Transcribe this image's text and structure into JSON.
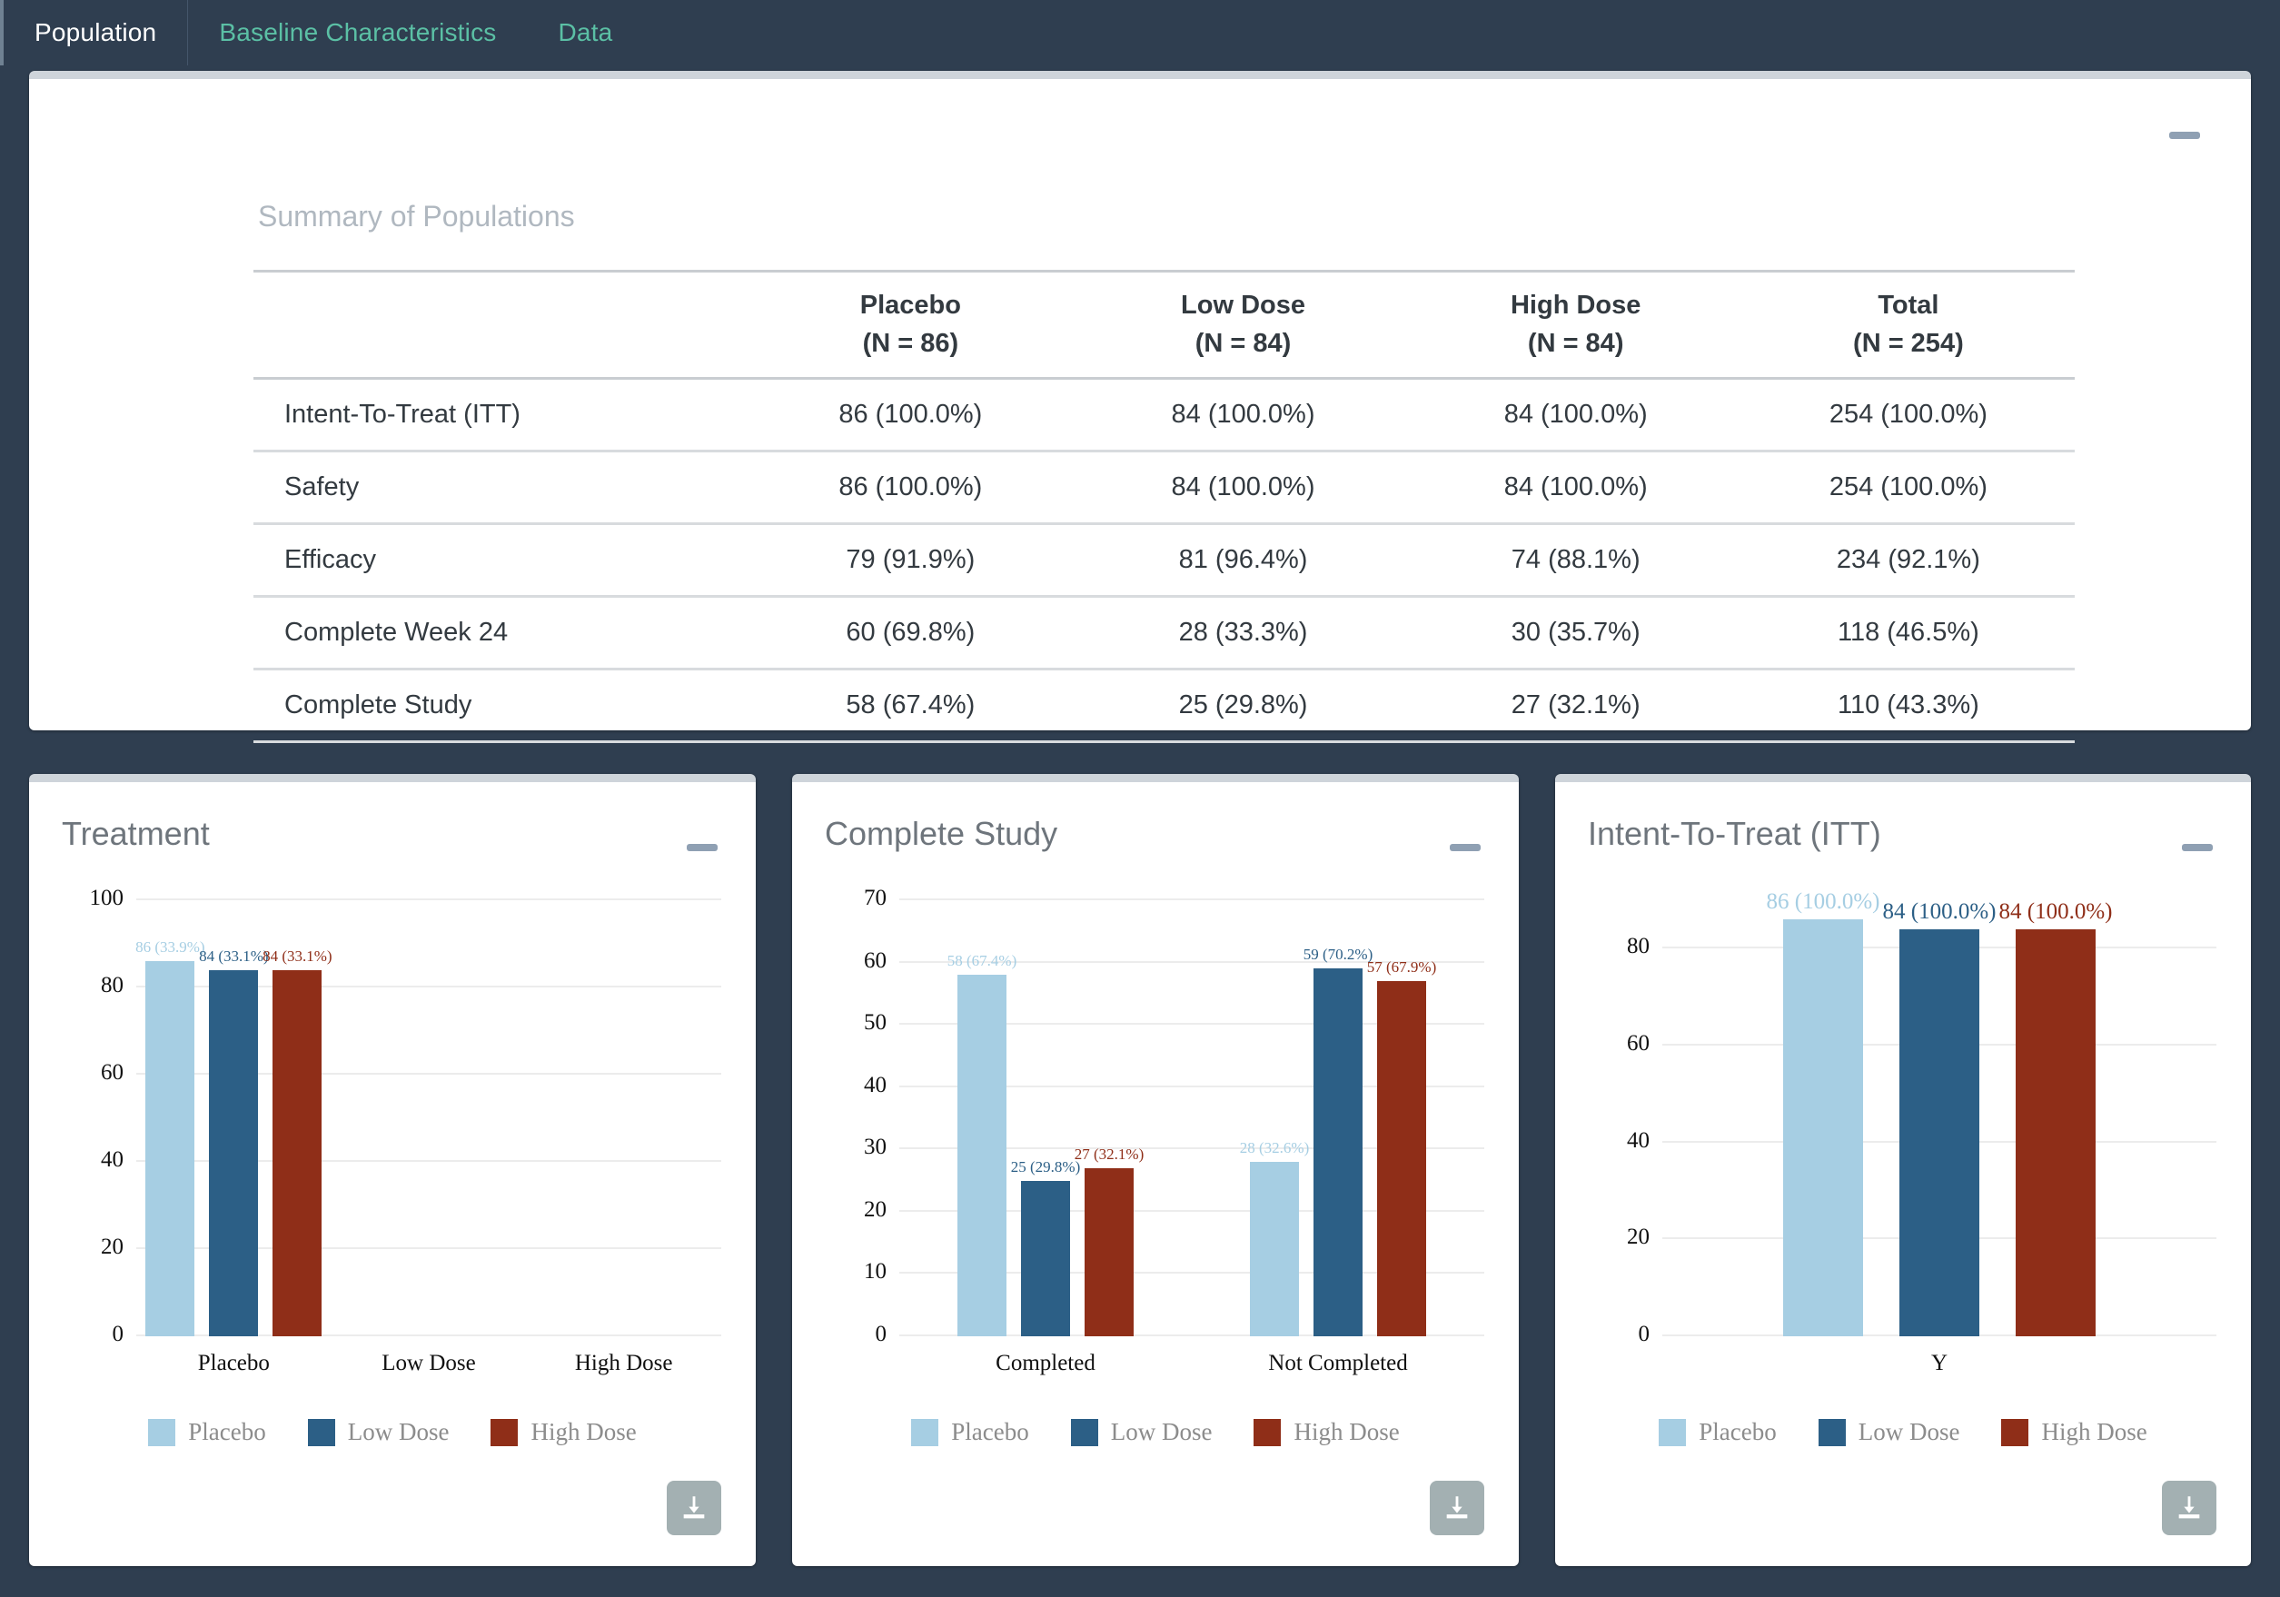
{
  "nav": {
    "tabs": [
      {
        "label": "Population",
        "active": true
      },
      {
        "label": "Baseline Characteristics",
        "active": false
      },
      {
        "label": "Data",
        "active": false
      }
    ]
  },
  "colors": {
    "placebo": "#a6cee3",
    "low_dose": "#2c5f86",
    "high_dose": "#8f2e18",
    "navy_bg": "#2f3e50",
    "tab_accent": "#5bc0a5",
    "card_top": "#ced4da"
  },
  "table_card": {
    "title": "Summary of Populations",
    "minimize_label": "—",
    "columns": [
      {
        "name": "",
        "sub": ""
      },
      {
        "name": "Placebo",
        "sub": "(N = 86)"
      },
      {
        "name": "Low Dose",
        "sub": "(N = 84)"
      },
      {
        "name": "High Dose",
        "sub": "(N = 84)"
      },
      {
        "name": "Total",
        "sub": "(N = 254)"
      }
    ],
    "rows": [
      {
        "label": "Intent-To-Treat (ITT)",
        "placebo": "86 (100.0%)",
        "low": "84 (100.0%)",
        "high": "84 (100.0%)",
        "total": "254 (100.0%)"
      },
      {
        "label": "Safety",
        "placebo": "86 (100.0%)",
        "low": "84 (100.0%)",
        "high": "84 (100.0%)",
        "total": "254 (100.0%)"
      },
      {
        "label": "Efficacy",
        "placebo": "79 (91.9%)",
        "low": "81 (96.4%)",
        "high": "74 (88.1%)",
        "total": "234 (92.1%)"
      },
      {
        "label": "Complete Week 24",
        "placebo": "60 (69.8%)",
        "low": "28 (33.3%)",
        "high": "30 (35.7%)",
        "total": "118 (46.5%)"
      },
      {
        "label": "Complete Study",
        "placebo": "58 (67.4%)",
        "low": "25 (29.8%)",
        "high": "27 (32.1%)",
        "total": "110 (43.3%)"
      }
    ]
  },
  "charts": [
    {
      "id": "treatment",
      "title": "Treatment",
      "minimize_label": "—",
      "download_label": "download",
      "legend": [
        {
          "label": "Placebo",
          "color": "#a6cee3"
        },
        {
          "label": "Low Dose",
          "color": "#2c5f86"
        },
        {
          "label": "High Dose",
          "color": "#8f2e18"
        }
      ]
    },
    {
      "id": "complete_study",
      "title": "Complete Study",
      "minimize_label": "—",
      "download_label": "download",
      "legend": [
        {
          "label": "Placebo",
          "color": "#a6cee3"
        },
        {
          "label": "Low Dose",
          "color": "#2c5f86"
        },
        {
          "label": "High Dose",
          "color": "#8f2e18"
        }
      ]
    },
    {
      "id": "itt",
      "title": "Intent-To-Treat (ITT)",
      "minimize_label": "—",
      "download_label": "download",
      "legend": [
        {
          "label": "Placebo",
          "color": "#a6cee3"
        },
        {
          "label": "Low Dose",
          "color": "#2c5f86"
        },
        {
          "label": "High Dose",
          "color": "#8f2e18"
        }
      ]
    }
  ],
  "chart_data": [
    {
      "type": "bar",
      "id": "treatment",
      "title": "Treatment",
      "xlabel": "",
      "ylabel": "",
      "categories": [
        "Placebo",
        "Low Dose",
        "High Dose"
      ],
      "series": [
        {
          "name": "Placebo",
          "color": "#a6cee3",
          "values": [
            86
          ],
          "labels": [
            "86 (33.9%)"
          ]
        },
        {
          "name": "Low Dose",
          "color": "#2c5f86",
          "values": [
            84
          ],
          "labels": [
            "84 (33.1%)"
          ]
        },
        {
          "name": "High Dose",
          "color": "#8f2e18",
          "values": [
            84
          ],
          "labels": [
            "84 (33.1%)"
          ]
        }
      ],
      "yticks": [
        0,
        20,
        40,
        60,
        80,
        100
      ],
      "ylim": [
        0,
        100
      ],
      "grid": true,
      "legend_position": "bottom"
    },
    {
      "type": "bar",
      "id": "complete_study",
      "title": "Complete Study",
      "xlabel": "",
      "ylabel": "",
      "categories": [
        "Completed",
        "Not Completed"
      ],
      "series": [
        {
          "name": "Placebo",
          "color": "#a6cee3",
          "values": [
            58,
            28
          ],
          "labels": [
            "58 (67.4%)",
            "28 (32.6%)"
          ]
        },
        {
          "name": "Low Dose",
          "color": "#2c5f86",
          "values": [
            25,
            59
          ],
          "labels": [
            "25 (29.8%)",
            "59 (70.2%)"
          ]
        },
        {
          "name": "High Dose",
          "color": "#8f2e18",
          "values": [
            27,
            57
          ],
          "labels": [
            "27 (32.1%)",
            "57 (67.9%)"
          ]
        }
      ],
      "yticks": [
        0,
        10,
        20,
        30,
        40,
        50,
        60,
        70
      ],
      "ylim": [
        0,
        70
      ],
      "grid": true,
      "legend_position": "bottom"
    },
    {
      "type": "bar",
      "id": "itt",
      "title": "Intent-To-Treat (ITT)",
      "xlabel": "Y",
      "ylabel": "",
      "categories": [
        "Y"
      ],
      "series": [
        {
          "name": "Placebo",
          "color": "#a6cee3",
          "values": [
            86
          ],
          "labels": [
            "86 (100.0%)"
          ]
        },
        {
          "name": "Low Dose",
          "color": "#2c5f86",
          "values": [
            84
          ],
          "labels": [
            "84 (100.0%)"
          ]
        },
        {
          "name": "High Dose",
          "color": "#8f2e18",
          "values": [
            84
          ],
          "labels": [
            "84 (100.0%)"
          ]
        }
      ],
      "yticks": [
        0,
        20,
        40,
        60,
        80
      ],
      "ylim": [
        0,
        90
      ],
      "grid": true,
      "legend_position": "bottom"
    }
  ]
}
